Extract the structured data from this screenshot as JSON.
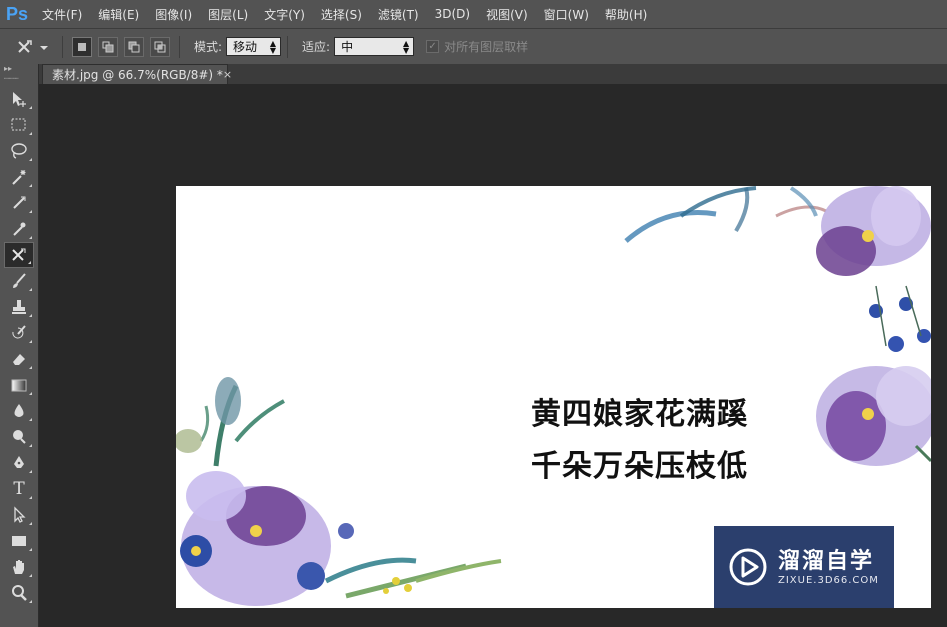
{
  "app": {
    "logo": "Ps"
  },
  "menu": [
    "文件(F)",
    "编辑(E)",
    "图像(I)",
    "图层(L)",
    "文字(Y)",
    "选择(S)",
    "滤镜(T)",
    "3D(D)",
    "视图(V)",
    "窗口(W)",
    "帮助(H)"
  ],
  "options": {
    "tool_icon": "content-aware-move-icon",
    "mode_label": "模式:",
    "mode_value": "移动",
    "adapt_label": "适应:",
    "adapt_value": "中",
    "sample_all_label": "对所有图层取样",
    "sample_all_checked": true
  },
  "document": {
    "tab_title": "素材.jpg @ 66.7%(RGB/8#) *",
    "close_glyph": "×",
    "poem_line1": "黄四娘家花满蹊",
    "poem_line2": "千朵万朵压枝低",
    "watermark_title": "溜溜自学",
    "watermark_sub": "ZIXUE.3D66.COM"
  },
  "tools": [
    {
      "name": "move-tool-icon"
    },
    {
      "name": "marquee-tool-icon"
    },
    {
      "name": "lasso-tool-icon"
    },
    {
      "name": "magic-wand-tool-icon"
    },
    {
      "name": "crop-tool-icon"
    },
    {
      "name": "eyedropper-tool-icon"
    },
    {
      "name": "content-aware-move-tool-icon",
      "active": true
    },
    {
      "name": "brush-tool-icon"
    },
    {
      "name": "stamp-tool-icon"
    },
    {
      "name": "history-brush-tool-icon"
    },
    {
      "name": "eraser-tool-icon"
    },
    {
      "name": "gradient-tool-icon"
    },
    {
      "name": "blur-tool-icon"
    },
    {
      "name": "dodge-tool-icon"
    },
    {
      "name": "pen-tool-icon"
    },
    {
      "name": "type-tool-icon",
      "glyph": "T"
    },
    {
      "name": "path-selection-tool-icon"
    },
    {
      "name": "rectangle-tool-icon"
    },
    {
      "name": "hand-tool-icon"
    },
    {
      "name": "zoom-tool-icon"
    }
  ],
  "colors": {
    "accent": "#4aa3f5",
    "watermark_bg": "#2b3f6d",
    "flower_purple": "#7b5fb3"
  }
}
